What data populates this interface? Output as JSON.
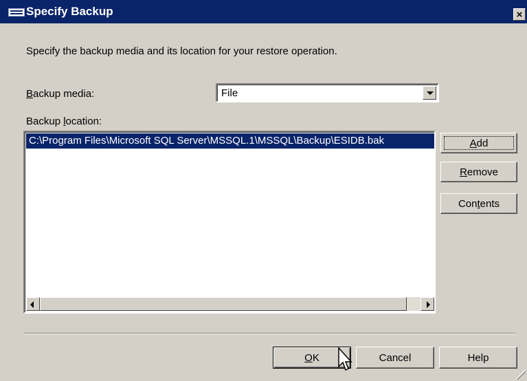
{
  "window": {
    "title": "Specify Backup",
    "close_label": "×"
  },
  "description": "Specify the backup media and its location for your restore operation.",
  "backup_media": {
    "label_mnemonic": "B",
    "label_rest": "ackup media:",
    "selected": "File"
  },
  "backup_location": {
    "label_prefix": "Backup ",
    "label_mnemonic": "l",
    "label_rest": "ocation:",
    "items": [
      "C:\\Program Files\\Microsoft SQL Server\\MSSQL.1\\MSSQL\\Backup\\ESIDB.bak"
    ]
  },
  "side_buttons": {
    "add_mnemonic": "A",
    "add_rest": "dd",
    "remove_mnemonic": "R",
    "remove_rest": "emove",
    "contents_prefix": "Con",
    "contents_mnemonic": "t",
    "contents_rest": "ents"
  },
  "footer_buttons": {
    "ok_mnemonic": "O",
    "ok_rest": "K",
    "cancel": "Cancel",
    "help": "Help"
  },
  "colors": {
    "titlebar": "#0a246a",
    "dialog_bg": "#d4d0c8",
    "selection": "#0a246a"
  },
  "icons": {
    "window": "window-icon",
    "close": "close-icon",
    "dropdown": "chevron-down-icon",
    "scroll_left": "arrow-left-icon",
    "scroll_right": "arrow-right-icon",
    "cursor": "mouse-pointer-icon",
    "grip": "resize-grip-icon"
  }
}
